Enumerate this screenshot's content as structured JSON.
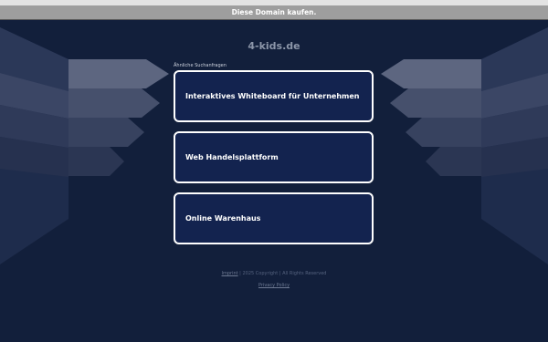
{
  "topbar": {
    "buy_domain_label": "Diese Domain kaufen."
  },
  "site": {
    "title": "4-kids.de"
  },
  "related": {
    "label": "Ähnliche Suchanfragen",
    "items": [
      {
        "label": "Interaktives Whiteboard für Unternehmen"
      },
      {
        "label": "Web Handelsplattform"
      },
      {
        "label": "Online Warenhaus"
      }
    ]
  },
  "footer": {
    "imprint_label": "Imprint",
    "copyright_text": " | 2025 Copyright | All Rights Reserved",
    "privacy_label": "Privacy Policy"
  },
  "colors": {
    "background": "#121f3b",
    "card_background": "#13234f",
    "card_border": "#ffffff",
    "topbar": "#9e9e9e"
  }
}
